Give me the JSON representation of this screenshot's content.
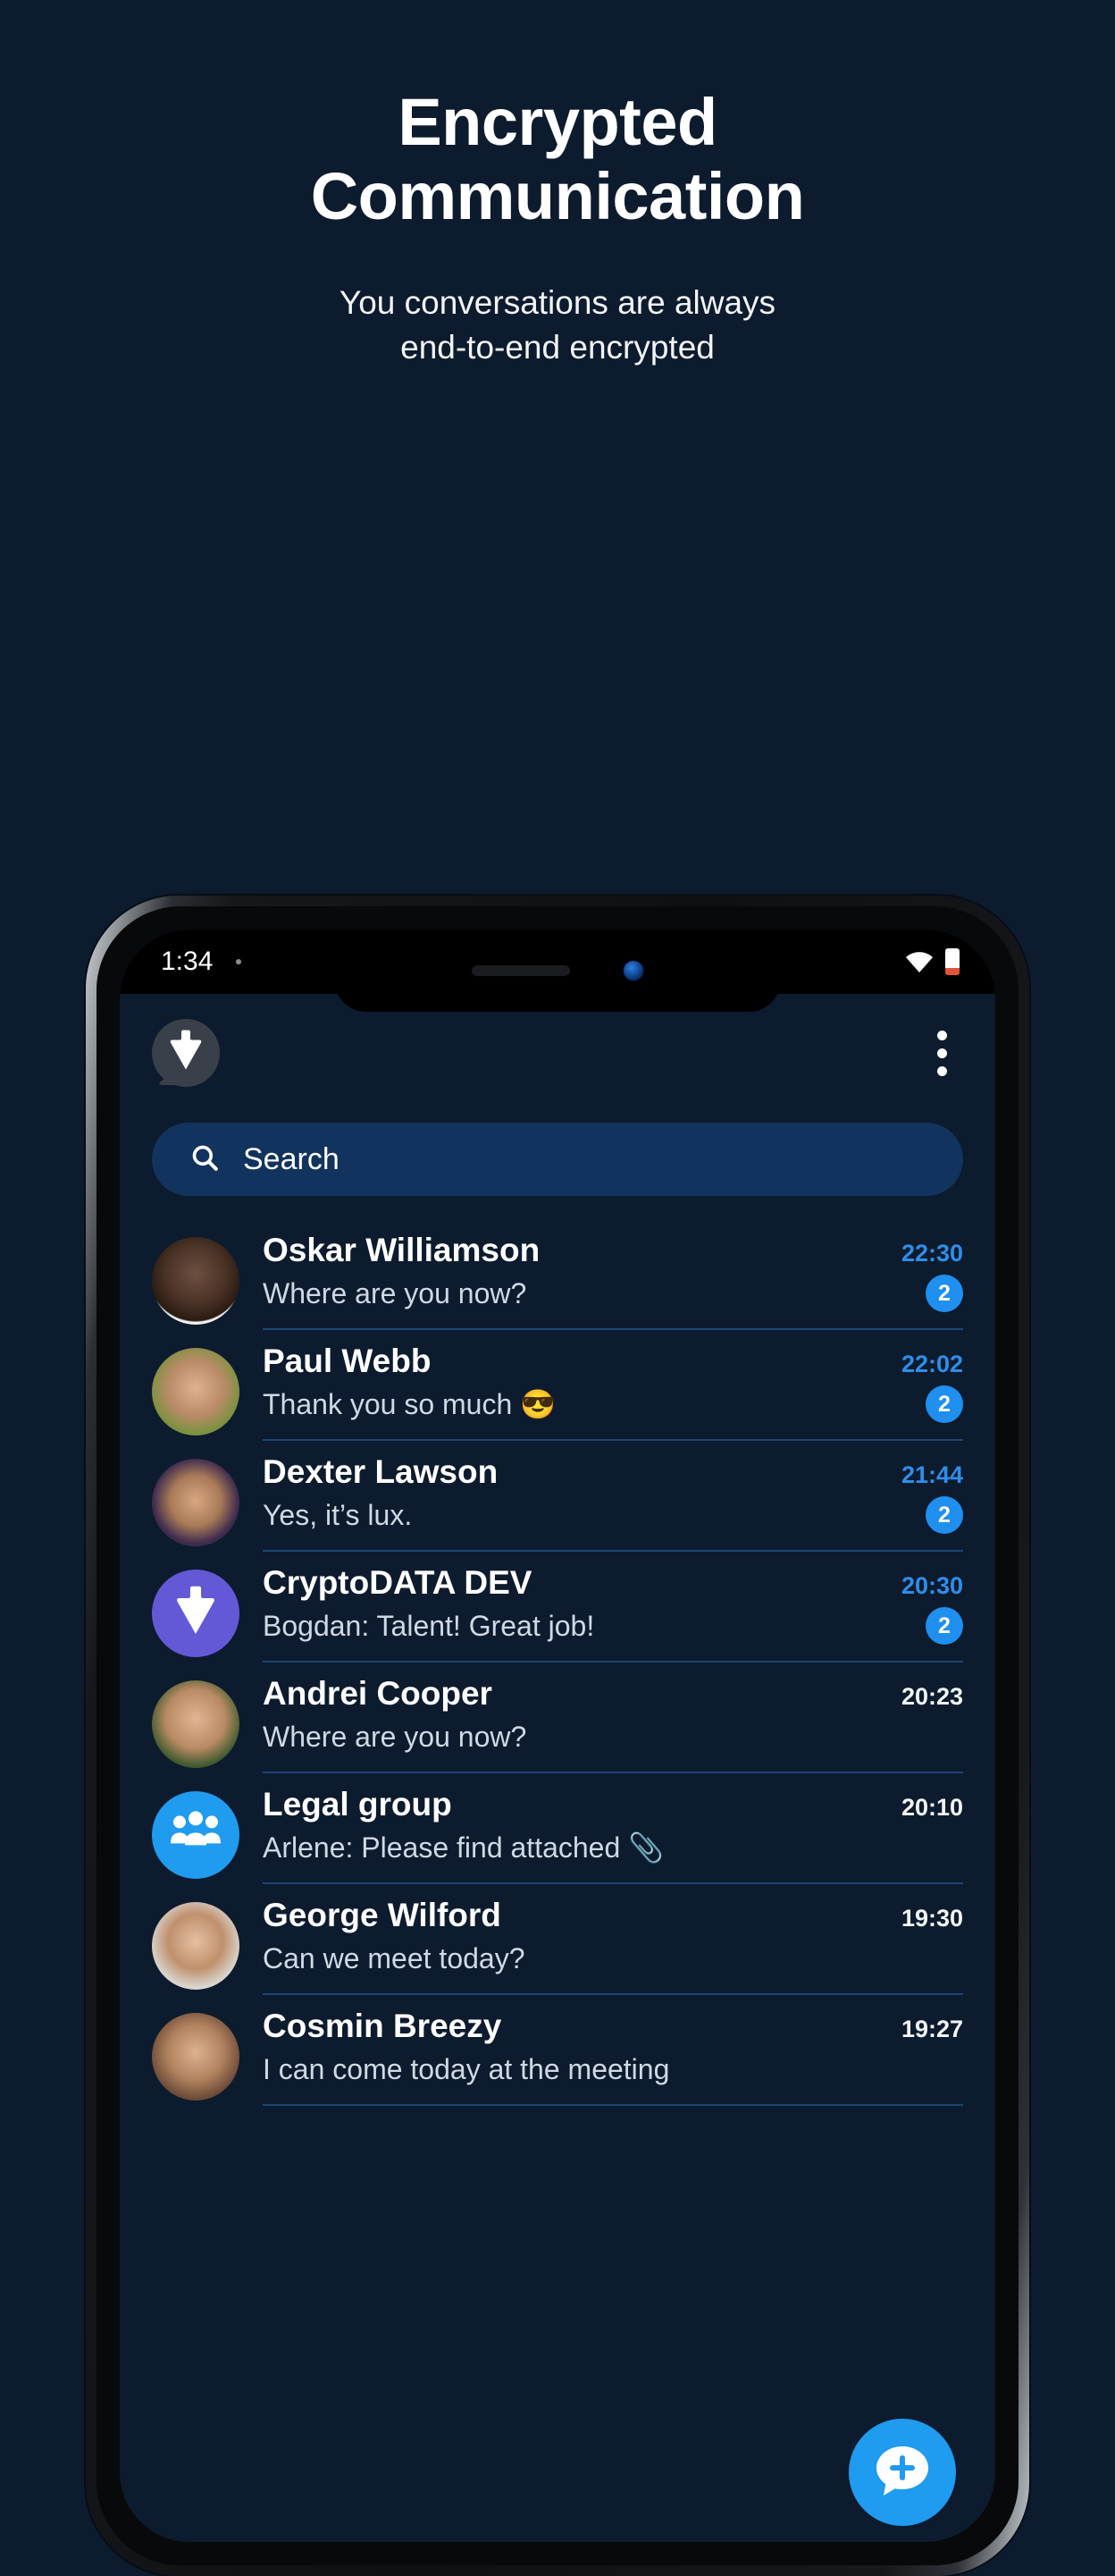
{
  "hero": {
    "title_line1": "Encrypted",
    "title_line2": "Communication",
    "subtitle_line1": "You conversations are always",
    "subtitle_line2": "end-to-end encrypted"
  },
  "colors": {
    "page_background": "#0d1b2e",
    "accent_blue": "#1f9bf0",
    "time_unread": "#2e8eea",
    "search_background": "#11335e",
    "divider": "#1d4577",
    "group_purple": "#6359d6"
  },
  "phone": {
    "status_bar": {
      "time": "1:34",
      "wifi_icon": "wifi-icon",
      "battery_icon": "battery-icon",
      "front_camera_icon": "front-camera-icon",
      "speaker_icon": "speaker-grille-icon"
    },
    "app_bar": {
      "logo_icon": "app-logo-chat-bubble-icon",
      "menu_icon": "overflow-menu-icon"
    },
    "search": {
      "placeholder": "Search",
      "icon": "search-icon"
    },
    "fab": {
      "icon": "new-chat-plus-icon"
    },
    "chats": [
      {
        "name": "Oskar Williamson",
        "preview": "Where are you now?",
        "time": "22:30",
        "unread": "2",
        "has_unread": true,
        "avatar_type": "photo",
        "avatar_class": "ph1"
      },
      {
        "name": "Paul Webb",
        "preview": "Thank you so much 😎",
        "time": "22:02",
        "unread": "2",
        "has_unread": true,
        "avatar_type": "photo",
        "avatar_class": "ph2"
      },
      {
        "name": "Dexter Lawson",
        "preview": "Yes, it’s lux.",
        "time": "21:44",
        "unread": "2",
        "has_unread": true,
        "avatar_type": "photo",
        "avatar_class": "ph3"
      },
      {
        "name": "CryptoDATA DEV",
        "preview": "Bogdan: Talent! Great job!",
        "time": "20:30",
        "unread": "2",
        "has_unread": true,
        "avatar_type": "logo",
        "avatar_class": "av-crypto"
      },
      {
        "name": "Andrei Cooper",
        "preview": "Where are you now?",
        "time": "20:23",
        "unread": "",
        "has_unread": false,
        "avatar_type": "photo",
        "avatar_class": "ph4"
      },
      {
        "name": "Legal group",
        "preview": "Arlene: Please find attached 📎",
        "time": "20:10",
        "unread": "",
        "has_unread": false,
        "avatar_type": "group",
        "avatar_class": "av-legal"
      },
      {
        "name": "George Wilford",
        "preview": "Can we meet today?",
        "time": "19:30",
        "unread": "",
        "has_unread": false,
        "avatar_type": "photo",
        "avatar_class": "ph5"
      },
      {
        "name": "Cosmin Breezy",
        "preview": "I can come today at the meeting",
        "time": "19:27",
        "unread": "",
        "has_unread": false,
        "avatar_type": "photo",
        "avatar_class": "ph6"
      }
    ]
  }
}
